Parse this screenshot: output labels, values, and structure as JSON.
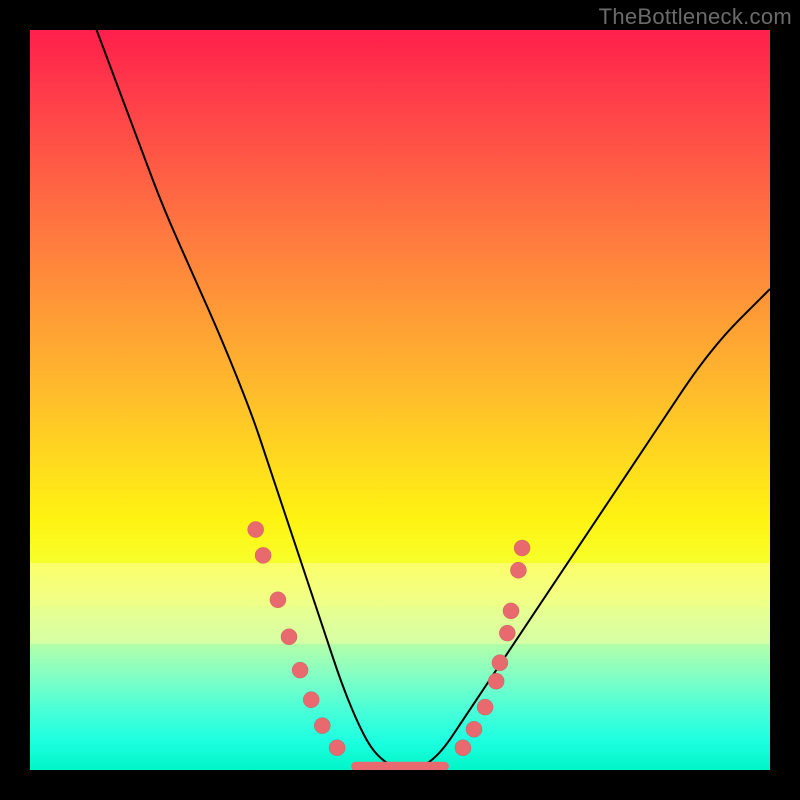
{
  "watermark": "TheBottleneck.com",
  "chart_data": {
    "type": "line",
    "title": "",
    "xlabel": "",
    "ylabel": "",
    "xlim": [
      0,
      100
    ],
    "ylim": [
      0,
      100
    ],
    "grid": false,
    "curve_description": "Asymmetric V-shaped bottleneck curve on a vertical rainbow gradient. Left branch starts at the top-left and descends steeply to a flat minimum near the center; right branch rises more gently toward the upper-right.",
    "series": [
      {
        "name": "bottleneck-curve",
        "x": [
          9,
          12,
          15,
          18,
          22,
          26,
          30,
          32,
          34,
          36,
          38,
          40,
          42,
          44,
          46,
          48,
          50,
          52,
          54,
          56,
          58,
          62,
          66,
          70,
          74,
          78,
          82,
          86,
          90,
          94,
          98,
          100
        ],
        "y": [
          100,
          92,
          84,
          76,
          67,
          58,
          48,
          42,
          36,
          30,
          24,
          18,
          12,
          7,
          3,
          1,
          0,
          0,
          1,
          3,
          6,
          12,
          18,
          24,
          30,
          36,
          42,
          48,
          54,
          59,
          63,
          65
        ]
      }
    ],
    "flat_minimum": {
      "x_start": 44,
      "x_end": 56,
      "y": 0.5
    },
    "markers_left": [
      {
        "x": 30.5,
        "y": 32.5
      },
      {
        "x": 31.5,
        "y": 29.0
      },
      {
        "x": 33.5,
        "y": 23.0
      },
      {
        "x": 35.0,
        "y": 18.0
      },
      {
        "x": 36.5,
        "y": 13.5
      },
      {
        "x": 38.0,
        "y": 9.5
      },
      {
        "x": 39.5,
        "y": 6.0
      },
      {
        "x": 41.5,
        "y": 3.0
      }
    ],
    "markers_right": [
      {
        "x": 58.5,
        "y": 3.0
      },
      {
        "x": 60.0,
        "y": 5.5
      },
      {
        "x": 61.5,
        "y": 8.5
      },
      {
        "x": 63.0,
        "y": 12.0
      },
      {
        "x": 63.5,
        "y": 14.5
      },
      {
        "x": 64.5,
        "y": 18.5
      },
      {
        "x": 65.0,
        "y": 21.5
      },
      {
        "x": 66.0,
        "y": 27.0
      },
      {
        "x": 66.5,
        "y": 30.0
      }
    ],
    "marker_radius_pct": 1.1,
    "background_bands": [
      {
        "top_pct": 72.0,
        "height_pct": 6.0,
        "color": "#ffff9e",
        "opacity": 0.55
      },
      {
        "top_pct": 78.0,
        "height_pct": 5.0,
        "color": "#f3ffa6",
        "opacity": 0.55
      }
    ]
  }
}
